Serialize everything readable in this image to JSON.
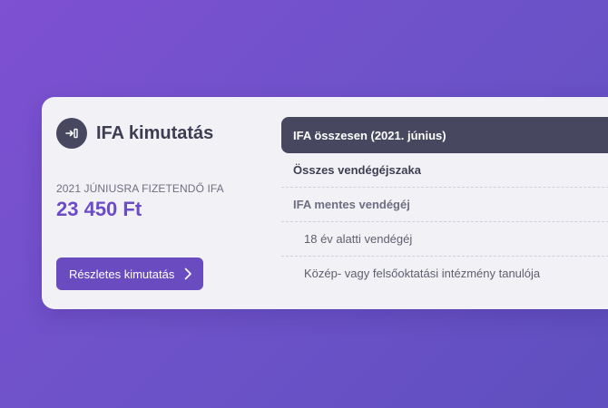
{
  "card": {
    "icon": "exit-to-box-icon",
    "title": "IFA kimutatás",
    "due_label": "2021 JÚNIUSRA FIZETENDŐ IFA",
    "due_amount": "23 450 Ft",
    "details_button": "Részletes kimutatás",
    "details_button_icon": "chevron-right-icon"
  },
  "table": {
    "header": "IFA összesen (2021. június)",
    "rows": [
      {
        "label": "Összes vendégéjszaka"
      },
      {
        "label": "IFA mentes vendégéj"
      },
      {
        "label": "18 év alatti vendégéj"
      },
      {
        "label": "Közép- vagy felsőoktatási intézmény tanulója"
      }
    ]
  },
  "colors": {
    "accent": "#6a4cc0",
    "dark": "#474760",
    "card_bg": "#f2f2f6"
  }
}
